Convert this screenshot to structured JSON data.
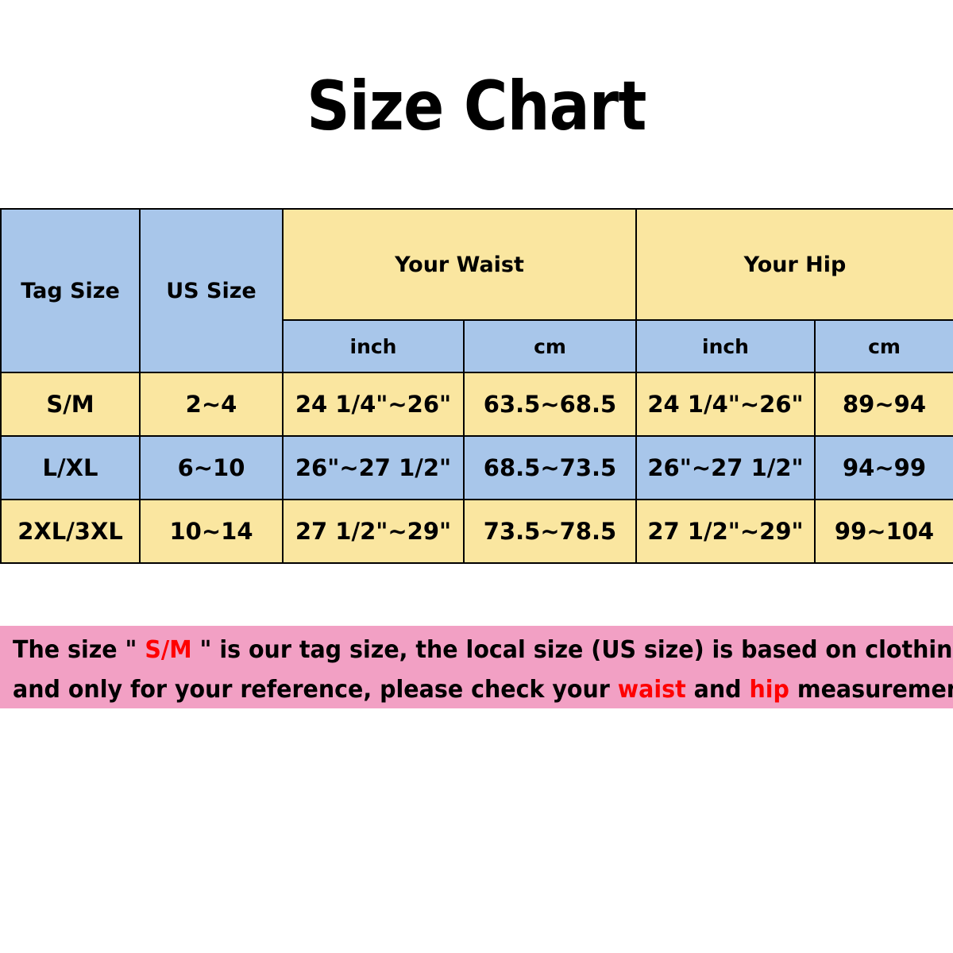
{
  "title": "Size Chart",
  "table": {
    "headers": {
      "tag_size": "Tag Size",
      "us_size": "US Size",
      "your_waist": "Your Waist",
      "your_hip": "Your Hip",
      "waist_inch": "inch",
      "waist_cm": "cm",
      "hip_inch": "inch",
      "hip_cm": "cm"
    },
    "rows": [
      {
        "tag_size": "S/M",
        "us_size": "2~4",
        "waist_inch": "24 1/4\"~26\"",
        "waist_cm": "63.5~68.5",
        "hip_inch": "24 1/4\"~26\"",
        "hip_cm": "89~94",
        "shade": "yellow"
      },
      {
        "tag_size": "L/XL",
        "us_size": "6~10",
        "waist_inch": "26\"~27 1/2\"",
        "waist_cm": "68.5~73.5",
        "hip_inch": "26\"~27 1/2\"",
        "hip_cm": "94~99",
        "shade": "blue"
      },
      {
        "tag_size": "2XL/3XL",
        "us_size": "10~14",
        "waist_inch": "27 1/2\"~29\"",
        "waist_cm": "73.5~78.5",
        "hip_inch": "27 1/2\"~29\"",
        "hip_cm": "99~104",
        "shade": "yellow"
      }
    ]
  },
  "note": {
    "line1_part1": "The size \" ",
    "line1_highlight": "S/M",
    "line1_part2": " \" is our tag size, the local size (US size) is based on clothing size",
    "line2_part1": "and only for your reference, please check your ",
    "line2_highlight1": "waist",
    "line2_part2": " and ",
    "line2_highlight2": "hip",
    "line2_part3": " measurements."
  },
  "colors": {
    "blue": "#a8c6ea",
    "yellow": "#fae6a0",
    "pink": "#f2a0c4",
    "highlight": "#ff0000",
    "border": "#000000",
    "text": "#000000"
  }
}
